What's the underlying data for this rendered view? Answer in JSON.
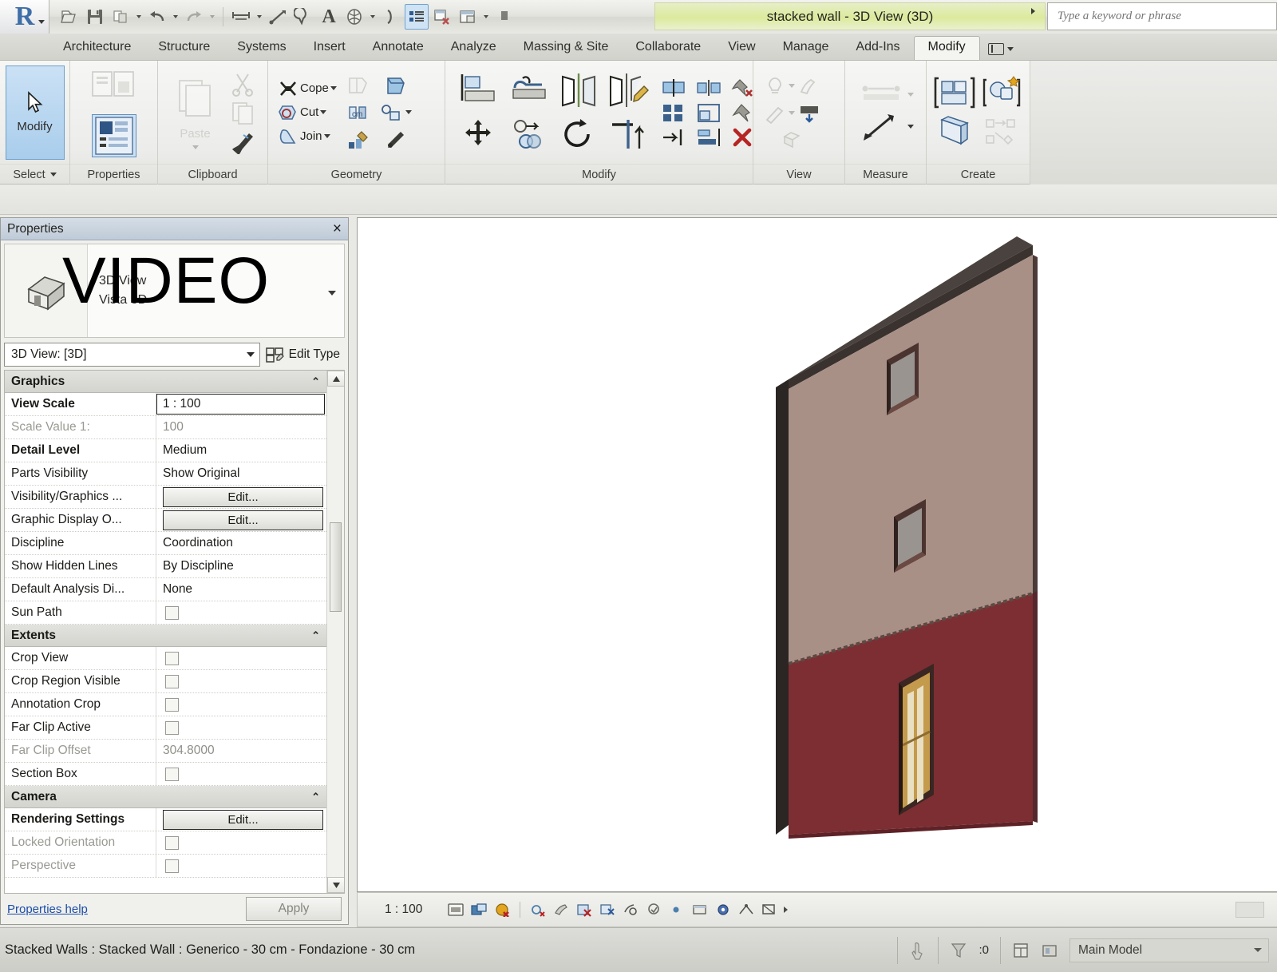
{
  "titlebar": {
    "app_logo": "revit-r-logo",
    "document_title": "stacked wall - 3D View (3D)",
    "search_placeholder": "Type a keyword or phrase",
    "quick_access": [
      {
        "name": "open-icon",
        "label": "Open"
      },
      {
        "name": "save-icon",
        "label": "Save"
      },
      {
        "name": "sync-icon",
        "label": "Synchronize"
      },
      {
        "name": "undo-icon",
        "label": "Undo"
      },
      {
        "name": "redo-icon",
        "label": "Redo"
      },
      {
        "name": "measure-icon",
        "label": "Measure"
      },
      {
        "name": "aligned-dimension-icon",
        "label": "Aligned Dimension"
      },
      {
        "name": "tag-icon",
        "label": "Tag by Category"
      },
      {
        "name": "text-icon",
        "label": "Text"
      },
      {
        "name": "default-3d-view-icon",
        "label": "Default 3D View"
      },
      {
        "name": "section-icon",
        "label": "Section"
      },
      {
        "name": "thin-lines-icon",
        "label": "Thin Lines"
      },
      {
        "name": "close-hidden-windows-icon",
        "label": "Close Hidden Windows"
      },
      {
        "name": "switch-windows-icon",
        "label": "Switch Windows"
      },
      {
        "name": "customize-qat-icon",
        "label": "Customize Quick Access Toolbar"
      }
    ]
  },
  "tabs": [
    {
      "label": "Architecture",
      "active": false
    },
    {
      "label": "Structure",
      "active": false
    },
    {
      "label": "Systems",
      "active": false
    },
    {
      "label": "Insert",
      "active": false
    },
    {
      "label": "Annotate",
      "active": false
    },
    {
      "label": "Analyze",
      "active": false
    },
    {
      "label": "Massing & Site",
      "active": false
    },
    {
      "label": "Collaborate",
      "active": false
    },
    {
      "label": "View",
      "active": false
    },
    {
      "label": "Manage",
      "active": false
    },
    {
      "label": "Add-Ins",
      "active": false
    },
    {
      "label": "Modify",
      "active": true
    }
  ],
  "ribbon": {
    "panels": [
      {
        "title": "Select",
        "has_dropdown": true
      },
      {
        "title": "Properties",
        "has_dropdown": false
      },
      {
        "title": "Clipboard",
        "has_dropdown": false
      },
      {
        "title": "Geometry",
        "has_dropdown": false
      },
      {
        "title": "Modify",
        "has_dropdown": false
      },
      {
        "title": "View",
        "has_dropdown": false
      },
      {
        "title": "Measure",
        "has_dropdown": false
      },
      {
        "title": "Create",
        "has_dropdown": false
      }
    ],
    "modify_button_label": "Modify",
    "properties_button_label": "Properties",
    "clipboard": {
      "paste_label": "Paste"
    },
    "geometry": {
      "cope_label": "Cope",
      "cut_label": "Cut",
      "join_label": "Join"
    }
  },
  "properties_panel": {
    "title": "Properties",
    "close_label": "×",
    "type_name_line1": "3D View",
    "type_name_line2": "Vista 3D",
    "type_selector_value": "3D View: [3D]",
    "edit_type_label": "Edit Type",
    "help_link": "Properties help",
    "apply_label": "Apply",
    "sections": [
      {
        "name": "Graphics",
        "rows": [
          {
            "name": "View Scale",
            "value": "1 : 100",
            "kind": "boxed",
            "bold": true
          },
          {
            "name": "Scale Value    1:",
            "value": "100",
            "kind": "text",
            "greyname": true,
            "greyval": true
          },
          {
            "name": "Detail Level",
            "value": "Medium",
            "kind": "text",
            "bold": true
          },
          {
            "name": "Parts Visibility",
            "value": "Show Original",
            "kind": "text"
          },
          {
            "name": "Visibility/Graphics ...",
            "value": "Edit...",
            "kind": "button"
          },
          {
            "name": "Graphic Display O...",
            "value": "Edit...",
            "kind": "button"
          },
          {
            "name": "Discipline",
            "value": "Coordination",
            "kind": "text"
          },
          {
            "name": "Show Hidden Lines",
            "value": "By Discipline",
            "kind": "text"
          },
          {
            "name": "Default Analysis Di...",
            "value": "None",
            "kind": "text"
          },
          {
            "name": "Sun Path",
            "value": "",
            "kind": "checkbox"
          }
        ]
      },
      {
        "name": "Extents",
        "rows": [
          {
            "name": "Crop View",
            "value": "",
            "kind": "checkbox"
          },
          {
            "name": "Crop Region Visible",
            "value": "",
            "kind": "checkbox"
          },
          {
            "name": "Annotation Crop",
            "value": "",
            "kind": "checkbox"
          },
          {
            "name": "Far Clip Active",
            "value": "",
            "kind": "checkbox"
          },
          {
            "name": "Far Clip Offset",
            "value": "304.8000",
            "kind": "text",
            "greyname": true,
            "greyval": true
          },
          {
            "name": "Section Box",
            "value": "",
            "kind": "checkbox"
          }
        ]
      },
      {
        "name": "Camera",
        "rows": [
          {
            "name": "Rendering Settings",
            "value": "Edit...",
            "kind": "button",
            "bold": true
          },
          {
            "name": "Locked Orientation",
            "value": "",
            "kind": "checkbox",
            "greyname": true
          },
          {
            "name": "Perspective",
            "value": "",
            "kind": "checkbox",
            "greyname": true
          }
        ]
      }
    ]
  },
  "view_control_bar": {
    "scale": "1 : 100",
    "icons": [
      {
        "name": "scale-icon",
        "label": "Scale"
      },
      {
        "name": "detail-level-icon",
        "label": "Detail Level"
      },
      {
        "name": "visual-style-icon",
        "label": "Visual Style"
      },
      {
        "name": "sun-path-icon",
        "label": "Sun Path"
      },
      {
        "name": "shadows-icon",
        "label": "Shadows"
      },
      {
        "name": "rendering-dialog-icon",
        "label": "Show Rendering Dialog"
      },
      {
        "name": "crop-view-icon",
        "label": "Crop View"
      },
      {
        "name": "crop-region-icon",
        "label": "Show Crop Region"
      },
      {
        "name": "lock-3d-view-icon",
        "label": "Lock 3D View"
      },
      {
        "name": "temporary-hide-isolate-icon",
        "label": "Temporary Hide/Isolate"
      },
      {
        "name": "reveal-hidden-icon",
        "label": "Reveal Hidden Elements"
      },
      {
        "name": "temporary-view-properties-icon",
        "label": "Temporary View Properties"
      },
      {
        "name": "analytical-model-icon",
        "label": "Show Analytical Model"
      },
      {
        "name": "constraints-icon",
        "label": "Reveal Constraints"
      }
    ]
  },
  "statusbar": {
    "selection_text": "Stacked Walls : Stacked Wall : Generico - 30 cm - Fondazione - 30 cm",
    "filter_count": ":0",
    "worksets_value": "Main Model"
  },
  "watermark": "VIDEO",
  "model": {
    "upper_wall_color": "#a99086",
    "lower_wall_color": "#7d2e33",
    "edge_color": "#2b2523",
    "door_color": "#c49a4c",
    "window_glass_color": "#9a9490",
    "background_color": "#ffffff"
  },
  "colors": {
    "accent": "#3f6ea8",
    "title_bar_highlight": "#dcea9c",
    "selection_blue": "#a9cdec",
    "link_blue": "#1c4ea8"
  }
}
